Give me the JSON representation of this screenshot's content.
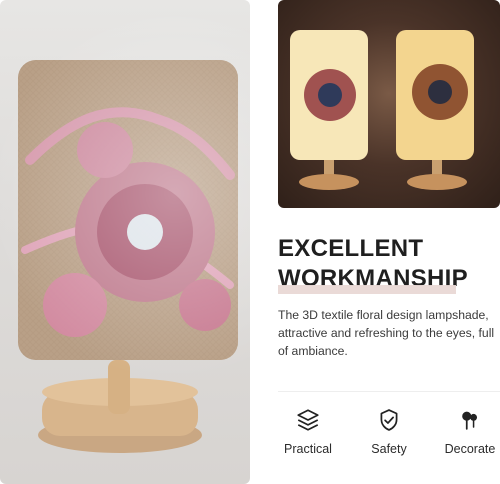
{
  "heading": {
    "line1": "EXCELLENT",
    "line2": "WORKMANSHIP"
  },
  "description": "The 3D textile floral design lampshade, attractive and refreshing to the eyes, full of ambiance.",
  "features": [
    {
      "label": "Practical",
      "icon": "stack-icon"
    },
    {
      "label": "Safety",
      "icon": "shield-check-icon"
    },
    {
      "label": "Decorate",
      "icon": "pushpin-icon"
    }
  ],
  "colors": {
    "heading_text": "#1f1f1f",
    "underline": "#e9d8d5",
    "description_text": "#3b3b3b",
    "feature_text": "#2b2b2b"
  }
}
